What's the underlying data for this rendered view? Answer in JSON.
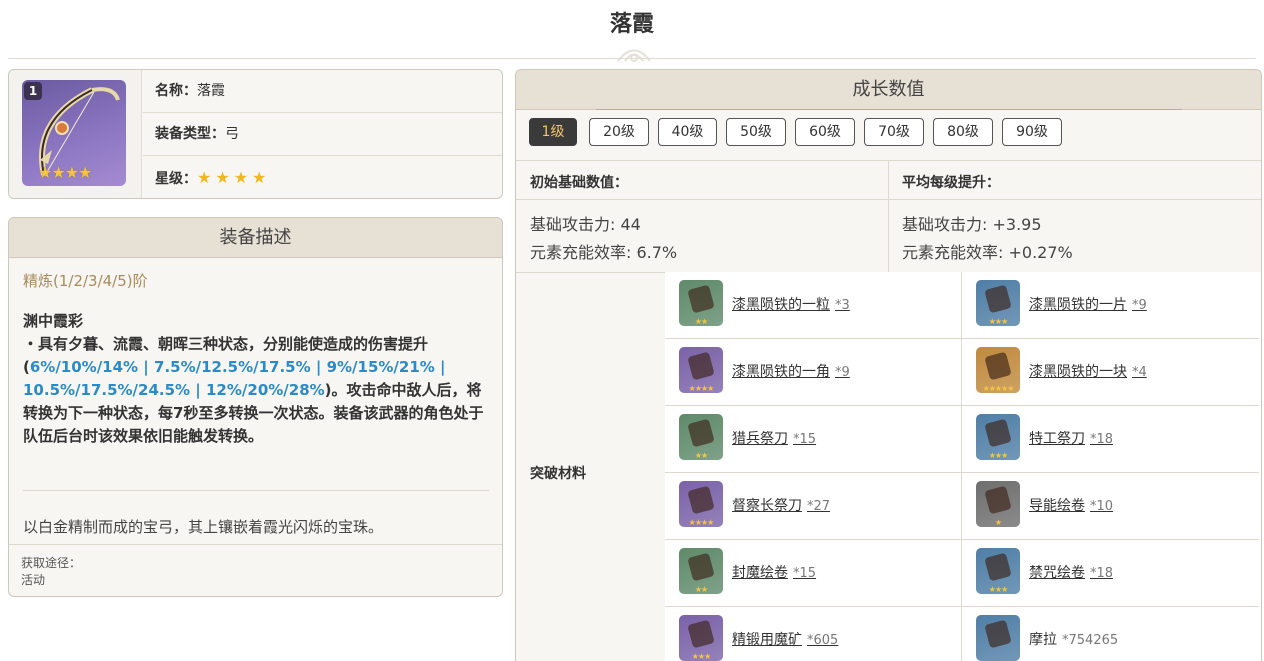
{
  "page": {
    "title": "落霞"
  },
  "info": {
    "rank": "1",
    "icon_stars": "★★★★",
    "name_label": "名称：",
    "name_value": "落霞",
    "type_label": "装备类型：",
    "type_value": "弓",
    "rarity_label": "星级：",
    "rarity_stars": "★★★★"
  },
  "description": {
    "header": "装备描述",
    "refine": "精炼(1/2/3/4/5)阶",
    "passive_name": "渊中霞彩",
    "passive_pre": "・具有夕暮、流霞、朝晖三种状态，分别能使造成的伤害提升(",
    "passive_values": "6%/10%/14% | 7.5%/12.5%/17.5% | 9%/15%/21% | 10.5%/17.5%/24.5% | 12%/20%/28%",
    "passive_post": ")。攻击命中敌人后，将转换为下一种状态，每7秒至多转换一次状态。装备该武器的角色处于队伍后台时该效果依旧能触发转换。",
    "lore": "以白金精制而成的宝弓，其上镶嵌着霞光闪烁的宝珠。",
    "source_label": "获取途径：",
    "source_value": "活动"
  },
  "growth": {
    "header": "成长数值",
    "levels": [
      "1级",
      "20级",
      "40级",
      "50级",
      "60级",
      "70级",
      "80级",
      "90级"
    ],
    "active_level": "1级",
    "base_header": "初始基础数值：",
    "avg_header": "平均每级提升：",
    "base_atk": "基础攻击力: 44",
    "base_er": "元素充能效率: 6.7%",
    "avg_atk": "基础攻击力: +3.95",
    "avg_er": "元素充能效率: +0.27%"
  },
  "materials": {
    "label": "突破材料",
    "items": [
      {
        "name": "漆黑陨铁的一粒",
        "count": "*3",
        "icon": "dark-iron-sliver-icon",
        "color": "#5f8a6a",
        "stars": "★★"
      },
      {
        "name": "漆黑陨铁的一片",
        "count": "*9",
        "icon": "dark-iron-fragment-icon",
        "color": "#4f7ea6",
        "stars": "★★★"
      },
      {
        "name": "漆黑陨铁的一角",
        "count": "*9",
        "icon": "dark-iron-chunk-icon",
        "color": "#7a62a8",
        "stars": "★★★★"
      },
      {
        "name": "漆黑陨铁的一块",
        "count": "*4",
        "icon": "dark-iron-block-icon",
        "color": "#c08a3e",
        "stars": "★★★★★"
      },
      {
        "name": "猎兵祭刀",
        "count": "*15",
        "icon": "hunters-sacrificial-knife-icon",
        "color": "#5f8a6a",
        "stars": "★★"
      },
      {
        "name": "特工祭刀",
        "count": "*18",
        "icon": "agents-sacrificial-knife-icon",
        "color": "#4f7ea6",
        "stars": "★★★"
      },
      {
        "name": "督察长祭刀",
        "count": "*27",
        "icon": "inspectors-sacrificial-knife-icon",
        "color": "#7a62a8",
        "stars": "★★★★"
      },
      {
        "name": "导能绘卷",
        "count": "*10",
        "icon": "divining-scroll-icon",
        "color": "#6e6e6e",
        "stars": "★"
      },
      {
        "name": "封魔绘卷",
        "count": "*15",
        "icon": "sealed-scroll-icon",
        "color": "#5f8a6a",
        "stars": "★★"
      },
      {
        "name": "禁咒绘卷",
        "count": "*18",
        "icon": "forbidden-curse-scroll-icon",
        "color": "#4f7ea6",
        "stars": "★★★"
      },
      {
        "name": "精锻用魔矿",
        "count": "*605",
        "icon": "mystic-enhancement-ore-icon",
        "color": "#7a62a8",
        "stars": "★★★"
      },
      {
        "name": "摩拉",
        "count": "*754265",
        "icon": "mora-icon",
        "color": "#4f7ea6",
        "stars": ""
      }
    ]
  }
}
